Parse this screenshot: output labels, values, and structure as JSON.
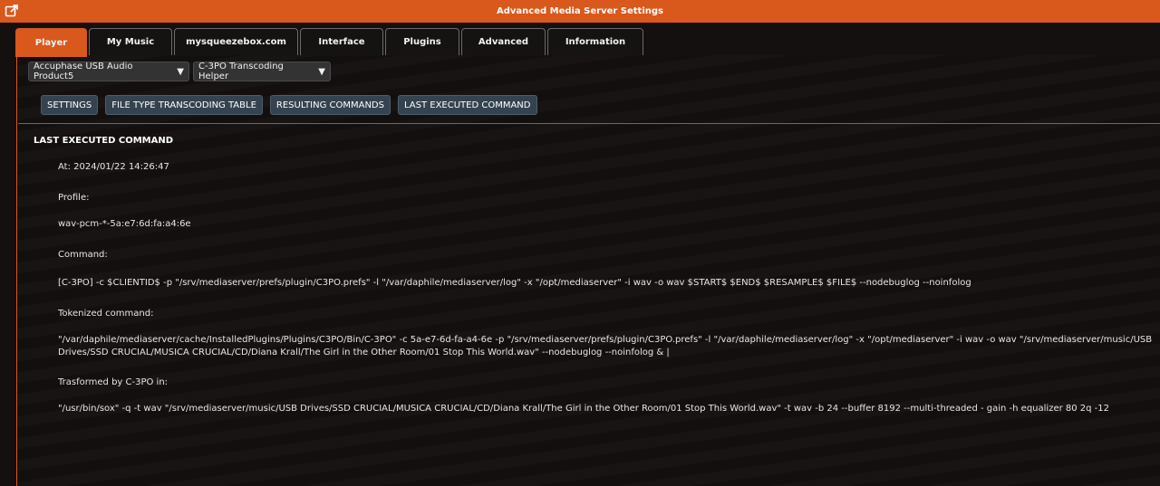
{
  "window": {
    "title": "Advanced Media Server Settings",
    "external_icon": "external-link-icon"
  },
  "tabs": [
    {
      "label": "Player",
      "active": true
    },
    {
      "label": "My Music",
      "active": false
    },
    {
      "label": "mysqueezebox.com",
      "active": false
    },
    {
      "label": "Interface",
      "active": false
    },
    {
      "label": "Plugins",
      "active": false
    },
    {
      "label": "Advanced",
      "active": false
    },
    {
      "label": "Information",
      "active": false
    }
  ],
  "selectors": {
    "player": "Accuphase USB Audio Product5",
    "plugin": "C-3PO Transcoding Helper"
  },
  "subtabs": [
    {
      "label": "SETTINGS"
    },
    {
      "label": "FILE TYPE TRANSCODING TABLE"
    },
    {
      "label": "RESULTING COMMANDS"
    },
    {
      "label": "LAST EXECUTED COMMAND"
    }
  ],
  "content": {
    "heading": "LAST EXECUTED COMMAND",
    "at": "At: 2024/01/22 14:26:47",
    "profile_label": "Profile:",
    "profile_value": "wav-pcm-*-5a:e7:6d:fa:a4:6e",
    "command_label": "Command:",
    "command_value": "[C-3PO] -c $CLIENTID$ -p \"/srv/mediaserver/prefs/plugin/C3PO.prefs\" -l \"/var/daphile/mediaserver/log\" -x \"/opt/mediaserver\" -i wav -o wav $START$ $END$ $RESAMPLE$ $FILE$ --nodebuglog --noinfolog",
    "tokenized_label": "Tokenized command:",
    "tokenized_value": "\"/var/daphile/mediaserver/cache/InstalledPlugins/Plugins/C3PO/Bin/C-3PO\" -c 5a-e7-6d-fa-a4-6e -p \"/srv/mediaserver/prefs/plugin/C3PO.prefs\" -l \"/var/daphile/mediaserver/log\" -x \"/opt/mediaserver\" -i wav -o wav \"/srv/mediaserver/music/USB Drives/SSD CRUCIAL/MUSICA CRUCIAL/CD/Diana Krall/The Girl in the Other Room/01 Stop This World.wav\" --nodebuglog --noinfolog & |",
    "transformed_label": "Trasformed by C-3PO in:",
    "transformed_value": "\"/usr/bin/sox\" -q -t wav \"/srv/mediaserver/music/USB Drives/SSD CRUCIAL/MUSICA CRUCIAL/CD/Diana Krall/The Girl in the Other Room/01 Stop This World.wav\" -t wav -b 24 --buffer 8192 --multi-threaded - gain -h equalizer 80 2q -12"
  },
  "colors": {
    "accent": "#d9581c",
    "background": "#141010",
    "subtab_bg": "#34434f"
  }
}
